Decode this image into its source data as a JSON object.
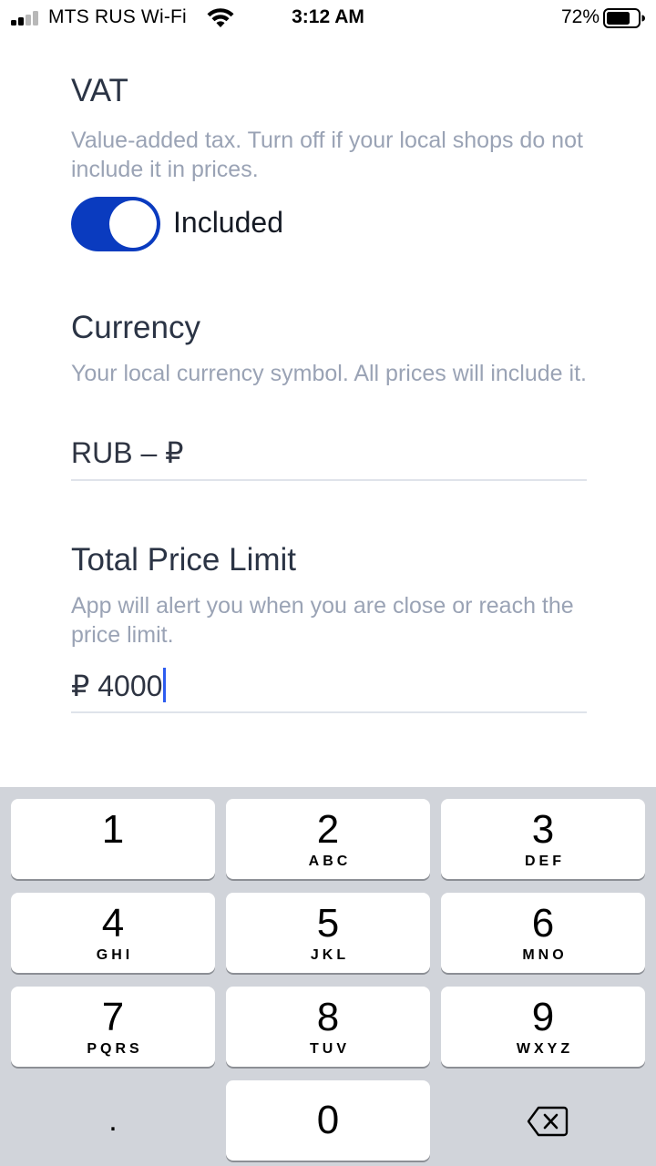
{
  "status_bar": {
    "carrier": "MTS RUS Wi-Fi",
    "time": "3:12 AM",
    "battery_percent": "72%"
  },
  "vat": {
    "title": "VAT",
    "description": "Value-added tax. Turn off if your local shops do not include it in prices.",
    "toggle_on": true,
    "toggle_label": "Included"
  },
  "currency": {
    "title": "Currency",
    "description": "Your local currency symbol. All prices will include it.",
    "value": "RUB – ₽"
  },
  "price_limit": {
    "title": "Total Price Limit",
    "description": "App will alert you when you are close or reach the price limit.",
    "value": "₽ 4000"
  },
  "keypad": {
    "keys": [
      {
        "num": "1",
        "letters": ""
      },
      {
        "num": "2",
        "letters": "ABC"
      },
      {
        "num": "3",
        "letters": "DEF"
      },
      {
        "num": "4",
        "letters": "GHI"
      },
      {
        "num": "5",
        "letters": "JKL"
      },
      {
        "num": "6",
        "letters": "MNO"
      },
      {
        "num": "7",
        "letters": "PQRS"
      },
      {
        "num": "8",
        "letters": "TUV"
      },
      {
        "num": "9",
        "letters": "WXYZ"
      },
      {
        "num": "0",
        "letters": ""
      }
    ],
    "dot": ".",
    "colors": {
      "accent": "#0a3bbf",
      "caret": "#2d5cf0",
      "background": "#d1d4da"
    }
  }
}
